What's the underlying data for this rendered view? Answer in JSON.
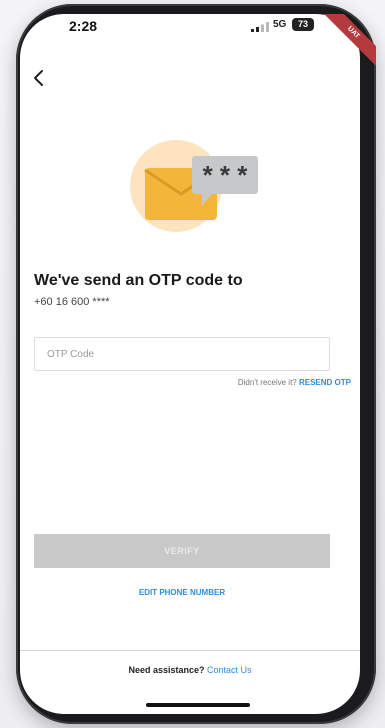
{
  "status_bar": {
    "time": "2:28",
    "network": "5G",
    "battery": "73",
    "ribbon": "UAT"
  },
  "nav": {
    "back_icon": "chevron-left-icon"
  },
  "illustration": {
    "icon": "envelope-password-icon",
    "masked_text": "* * *"
  },
  "otp": {
    "title": "We've send an OTP code to",
    "phone": "+60 16 600 ****",
    "input_placeholder": "OTP Code",
    "input_value": "",
    "resend_prompt": "Didn't receive it?",
    "resend_label": "RESEND OTP"
  },
  "actions": {
    "verify_label": "VERIFY",
    "edit_phone_label": "EDIT PHONE NUMBER"
  },
  "footer": {
    "assist_text": "Need assistance?",
    "contact_label": "Contact Us"
  },
  "colors": {
    "link": "#2d8de0",
    "disabled_button": "#c9c9c9",
    "envelope": "#f3b53a",
    "bubble": "#c7c8c9",
    "ribbon": "#b53a3d"
  }
}
